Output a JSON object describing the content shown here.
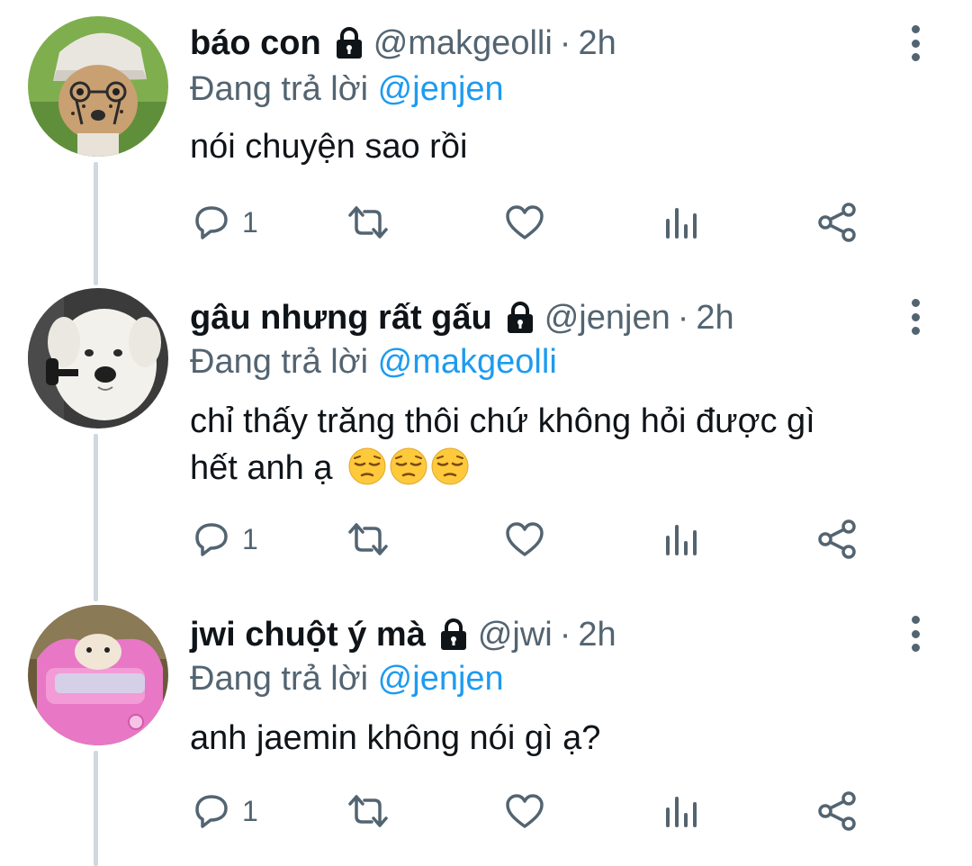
{
  "tweets": [
    {
      "name": "báo con",
      "handle": "@makgeolli",
      "separator": "·",
      "time": "2h",
      "replying_prefix": "Đang trả lời",
      "replying_to": "@jenjen",
      "text": "nói chuyện sao rồi",
      "reply_count": "1",
      "avatar_icon": "cheetah-avatar"
    },
    {
      "name": "gâu nhưng rất gấu",
      "handle": "@jenjen",
      "separator": "·",
      "time": "2h",
      "replying_prefix": "Đang trả lời",
      "replying_to": "@makgeolli",
      "text_line1": "chỉ thấy trăng thôi chứ không hỏi được gì",
      "text_line2": "hết anh ạ",
      "emojis": [
        "pensive-face",
        "pensive-face",
        "pensive-face"
      ],
      "reply_count": "1",
      "avatar_icon": "white-dog-avatar"
    },
    {
      "name": "jwi chuột ý mà",
      "handle": "@jwi",
      "separator": "·",
      "time": "2h",
      "replying_prefix": "Đang trả lời",
      "replying_to": "@jenjen",
      "text": "anh jaemin không nói gì ạ?",
      "reply_count": "1",
      "avatar_icon": "hamster-in-pink-car-avatar"
    }
  ],
  "colors": {
    "text": "#0f1419",
    "secondary": "#536471",
    "link": "#1d9bf0",
    "thread_line": "#cfd9de"
  }
}
